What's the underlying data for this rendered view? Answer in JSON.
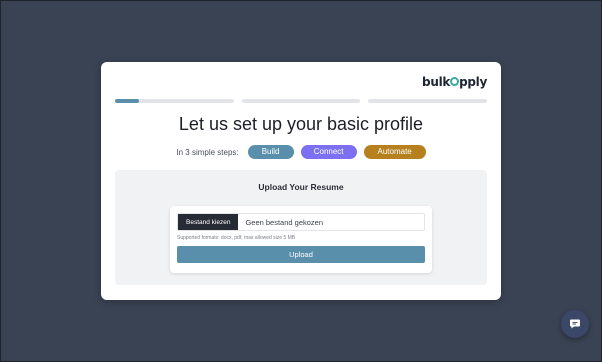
{
  "brand": {
    "logo_text_left": "bulk",
    "logo_text_right": "pply",
    "accent": "#3aa9a0"
  },
  "progress": {
    "steps": 3,
    "current_step_fill": 0.2
  },
  "heading": {
    "title": "Let us set up your basic profile"
  },
  "steps": {
    "label": "In 3 simple steps:",
    "items": [
      {
        "label": "Build",
        "color": "#5a8fab"
      },
      {
        "label": "Connect",
        "color": "#7c6ff2"
      },
      {
        "label": "Automate",
        "color": "#b5801d"
      }
    ]
  },
  "resume": {
    "title": "Upload Your Resume",
    "choose_file_label": "Bestand kiezen",
    "file_status": "Geen bestand gekozen",
    "hint": "Supported formats: docx, pdf, max allowed size 5 MB",
    "upload_label": "Upload"
  },
  "chat": {
    "icon": "chat-bubble-icon"
  }
}
